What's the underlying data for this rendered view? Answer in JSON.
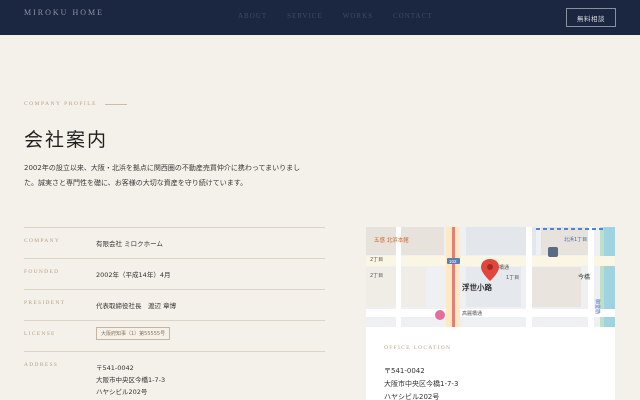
{
  "header": {
    "brand": "MIROKU HOME",
    "nav": [
      "ABOUT",
      "SERVICE",
      "WORKS",
      "CONTACT"
    ],
    "cta_label": "無料相談"
  },
  "section": {
    "eyebrow": "COMPANY PROFILE",
    "title": "会社案内",
    "lead_line1": "2002年の設立以来、大阪・北浜を拠点に関西圏の不動産売買仲介に携わってまいりまし",
    "lead_line2": "た。誠実さと専門性を礎に、お客様の大切な資産を守り続けています。"
  },
  "info": {
    "company_key": "COMPANY",
    "company_val": "有限会社 ミロクホーム",
    "founded_key": "FOUNDED",
    "founded_val": "2002年（平成14年）4月",
    "president_key": "PRESIDENT",
    "president_val": "代表取締役社長　渡辺 章博",
    "license_key": "LICENSE",
    "license_val": "大阪府知事（1）第55555号",
    "address_key": "ADDRESS",
    "address_line1": "〒541-0042",
    "address_line2": "大阪市中央区今橋1-7-3",
    "address_line3": "ハヤシビル202号"
  },
  "map": {
    "labels": {
      "kitahama": "五感 北浜本館",
      "imabashi": "今橋通",
      "ukiyo": "浮世小路",
      "chome2a": "2丁目",
      "chome2b": "2丁目",
      "chome1": "1丁目",
      "imabashi2": "今橋",
      "koraibashi": "高麗橋通",
      "road_no": "102",
      "top_right": "北浜1丁目",
      "side": "御堂筋"
    },
    "office_label": "OFFICE LOCATION",
    "addr_line1": "〒541-0042",
    "addr_line2": "大阪市中央区今橋1-7-3",
    "addr_line3": "ハヤシビル202号"
  },
  "colors": {
    "header_bg": "#1b2740",
    "page_bg": "#f4f0ea",
    "accent_gold": "#b6a487",
    "pin_red": "#e0463c"
  }
}
